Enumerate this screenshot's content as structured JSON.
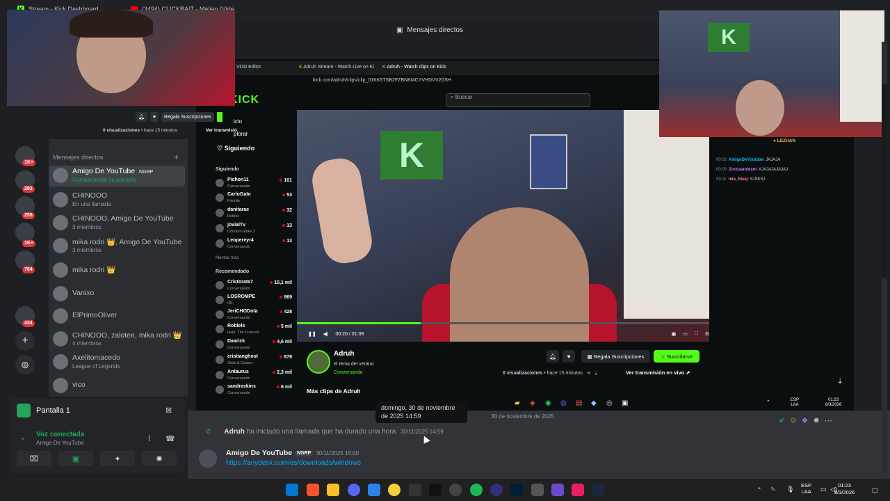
{
  "browser": {
    "tabs": [
      {
        "label": "Stream - Kick Dashboard"
      },
      {
        "label": "(3494) CLICKBAIT - Melian (Vide"
      }
    ]
  },
  "discord": {
    "header_title": "Mensajes directos",
    "dm_header": "Mensajes directos",
    "server_badges": [
      "1K+",
      "292",
      "255",
      "1K+",
      "764",
      "434"
    ],
    "dms": [
      {
        "name": "Amigo De YouTube",
        "tag": "NGRP",
        "sub": "Compartiendo su pantalla"
      },
      {
        "name": "CHINOOO",
        "sub": "En una llamada"
      },
      {
        "name": "CHINOOO, Amigo De YouTube",
        "sub": "3 miembros"
      },
      {
        "name": "mika rodri 👑, Amigo De YouTube",
        "sub": "3 miembros"
      },
      {
        "name": "mika rodri 👑",
        "sub": ""
      },
      {
        "name": "Vanixo",
        "sub": ""
      },
      {
        "name": "ElPrimoOliver",
        "sub": ""
      },
      {
        "name": "CHINOOO, zalotee, mika rodri 👑",
        "sub": "4 miembros"
      },
      {
        "name": "Axelitomacedo",
        "sub": "League of Legends"
      },
      {
        "name": "vico",
        "sub": ""
      }
    ],
    "voice": {
      "screen_label": "Pantalla 1",
      "status": "Voz conectada",
      "channel": "Amigo De YouTube"
    },
    "chat": {
      "tooltip_line1": "domingo, 30 de noviembre",
      "tooltip_line2": "de 2025 14:59",
      "date_divider": "30 de noviembre de 2025",
      "call_author": "Adruh",
      "call_text": "ha iniciado una llamada que ha durado una hora.",
      "call_time": "30/11/2025 14:59",
      "msg_author": "Amigo De YouTube",
      "msg_tag": "NGRP",
      "msg_time": "30/11/2025 15:00",
      "msg_link": "https://anydesk.com/es/downloads/windows"
    }
  },
  "kick": {
    "tabs": [
      "VOD Editor",
      "Adruh Stream - Watch Live on Ki",
      "Adruh - Watch clips on Kick"
    ],
    "url": "kick.com/adruh/clips/clip_01KK5TSB2FZBNKMCYVHDVV2G5H",
    "logo": "KICK",
    "search_placeholder": "Buscar",
    "following_title": "Siguiendo",
    "following_header": "Siguiendo",
    "following": [
      {
        "name": "Pichon11",
        "cat": "Conversando",
        "viewers": "101"
      },
      {
        "name": "CarloGato",
        "cat": "Fortnite",
        "viewers": "53"
      },
      {
        "name": "danitarac",
        "cat": "Roblox",
        "viewers": "32"
      },
      {
        "name": "jovialTv",
        "cat": "Counter-Strike 2",
        "viewers": "13"
      },
      {
        "name": "Leopereyr4",
        "cat": "Conversando",
        "viewers": "13"
      }
    ],
    "show_more": "Mostrar más",
    "recommended_header": "Recomendado",
    "recommended": [
      {
        "name": "Cristorata7",
        "cat": "Conversando",
        "viewers": "15,1 mil"
      },
      {
        "name": "LOSROMPE",
        "cat": "IRL",
        "viewers": "969"
      },
      {
        "name": "JeriCHODota",
        "cat": "Conversando",
        "viewers": "428"
      },
      {
        "name": "Roblels",
        "cat": "Halo: The Fracture",
        "viewers": "5 mil"
      },
      {
        "name": "Daarick",
        "cat": "Conversando",
        "viewers": "4,6 mil"
      },
      {
        "name": "cristianghost",
        "cat": "Slots & Casino",
        "viewers": "879"
      },
      {
        "name": "Antaurus",
        "cat": "Conversando",
        "viewers": "2,3 mil"
      },
      {
        "name": "sandraskins",
        "cat": "Conversando",
        "viewers": "6 mil"
      }
    ],
    "video": {
      "time": "00:20 / 01:09",
      "progress": 0.3,
      "k_letter": "K"
    },
    "channel": {
      "name": "Adruh",
      "title": "el tema del verano",
      "category": "Conversando",
      "gift_label": "Regala Suscripciones",
      "sub_label": "Suscribirse",
      "views": "0 visualizaciones",
      "ago": "hace 15 minutos",
      "ver_live": "Ver transmisión en vivo",
      "more_clips": "Más clips de Adruh"
    },
    "chat": [
      {
        "time": "00:02",
        "user": "AmigoDeYoutube",
        "text": "JAJAJA",
        "color": "#00c3ff"
      },
      {
        "time": "00:09",
        "user": "Zoccaandesm",
        "text": "AJAJAJAJAJAJ",
        "color": "#b388ff"
      },
      {
        "time": "00:11",
        "user": "mia_fdsaj",
        "text": "SJSKSJ",
        "color": "#ff80ab"
      }
    ],
    "chat_top_user": "LEZHAN",
    "mini": {
      "gift_label": "Regala Suscripciones",
      "views": "0 visualizaciones",
      "ago": "hace 15 minutos",
      "ver": "Ver transmisió",
      "menu1": "icio",
      "menu2": "plorar"
    }
  },
  "taskbar": {
    "lang": "ESP",
    "lang2": "LAA",
    "time": "01:23",
    "date": "8/3/2026",
    "inner_lang": "ESP",
    "inner_lang2": "LAA",
    "inner_time": "01:23",
    "inner_date": "8/3/2026"
  },
  "colors": {
    "kick_green": "#53fc18",
    "discord_bg": "#313338",
    "link": "#00a8fc",
    "live_red": "#eb0400"
  }
}
